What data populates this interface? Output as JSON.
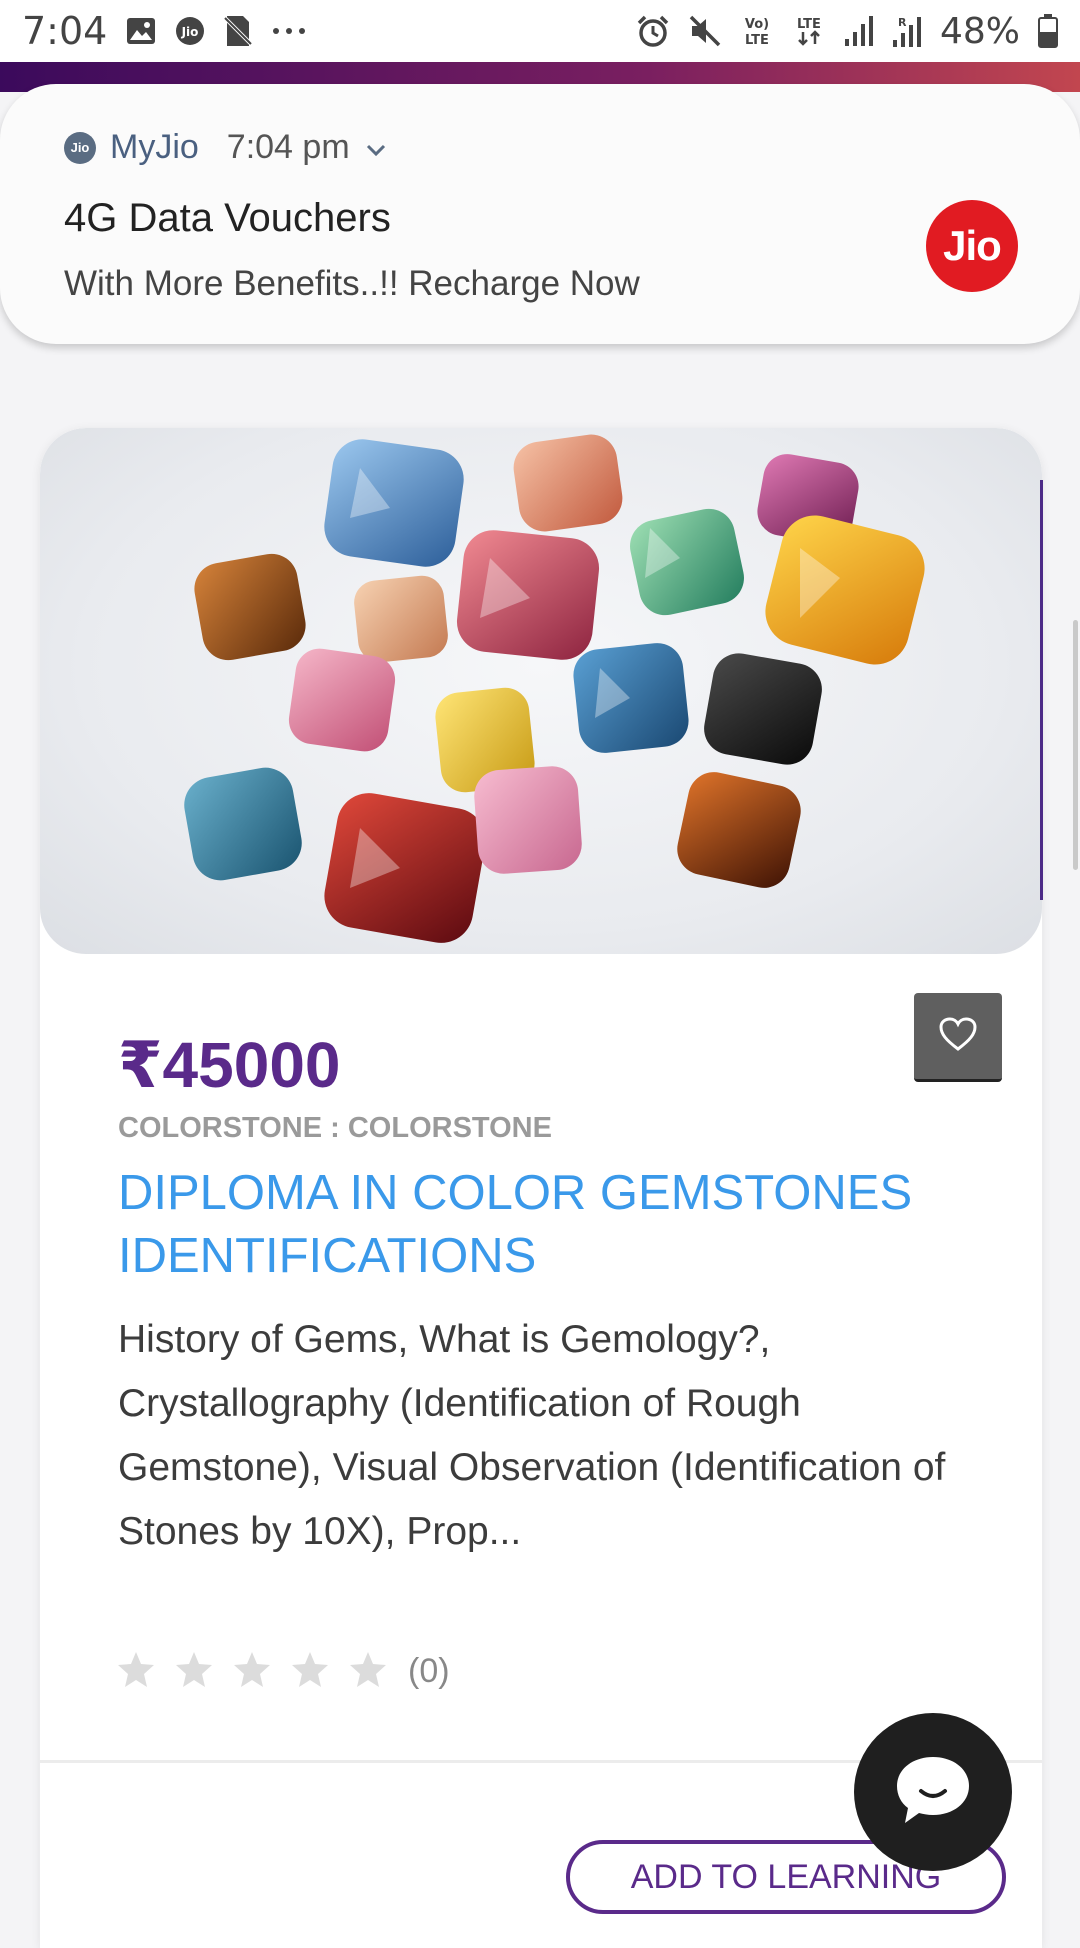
{
  "status_bar": {
    "time": "7:04",
    "battery": "48%",
    "left_icons": [
      "gallery-icon",
      "jio-icon",
      "no-sim-icon",
      "more-dots-icon"
    ],
    "right_icons": [
      "alarm-icon",
      "mute-icon",
      "volte-icon",
      "lte-data-icon",
      "signal-icon",
      "signal-roaming-icon",
      "battery-icon"
    ]
  },
  "notification": {
    "app_icon_label": "Jio",
    "app_name": "MyJio",
    "time": "7:04 pm",
    "title": "4G Data Vouchers",
    "body": "With More Benefits..!! Recharge Now",
    "logo_text": "Jio",
    "logo_color": "#e11b22"
  },
  "course": {
    "image_subject": "assorted colored gemstones",
    "price": "₹45000",
    "category": "COLORSTONE : COLORSTONE",
    "title": "DIPLOMA IN COLOR GEMSTONES IDENTIFICATIONS",
    "description": "History of Gems, What is Gemology?, Crystallography (Identification of Rough Gemstone), Visual Observation (Identification of Stones by 10X), Prop...",
    "rating_stars": 0,
    "rating_max": 5,
    "rating_count": "(0)",
    "add_button_label": "ADD TO LEARNING"
  },
  "colors": {
    "brand_purple": "#5a2a8a",
    "title_blue": "#3a99ea",
    "star_gray": "#dcdcdc"
  }
}
